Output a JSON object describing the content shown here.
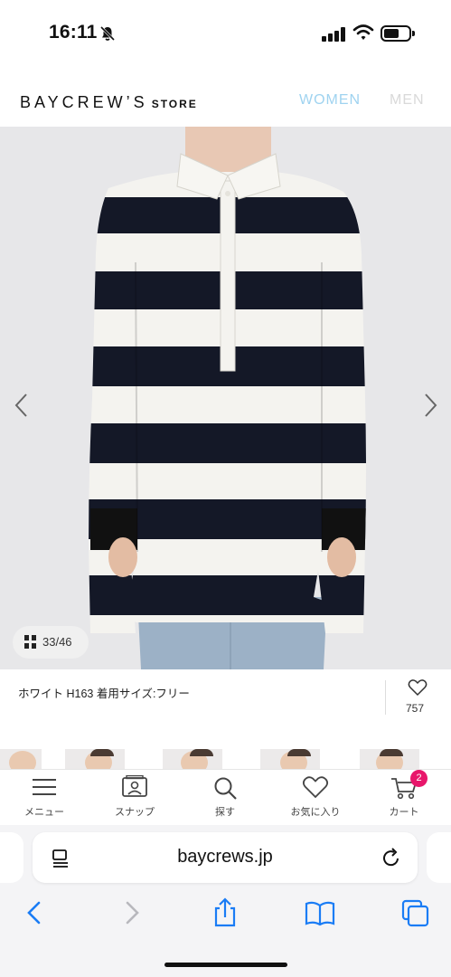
{
  "status_bar": {
    "time": "16:11",
    "icons": [
      "bell-slash-icon",
      "signal-icon",
      "wifi-icon",
      "battery-icon"
    ]
  },
  "header": {
    "logo_main": "BAYCREW’S",
    "logo_sub": "STORE",
    "nav": [
      {
        "label": "WOMEN",
        "color": "#9fd3f0",
        "active": true
      },
      {
        "label": "MEN",
        "color": "#d9d9d9",
        "active": false
      }
    ]
  },
  "gallery": {
    "counter": "33/46",
    "prev_icon": "chevron-left-icon",
    "next_icon": "chevron-right-icon"
  },
  "caption": {
    "text": "ホワイト H163 着用サイズ:フリー",
    "likes": "757",
    "like_icon": "heart-outline-icon"
  },
  "app_nav": {
    "items": [
      {
        "label": "メニュー",
        "icon": "menu-icon"
      },
      {
        "label": "スナップ",
        "icon": "snap-icon"
      },
      {
        "label": "探す",
        "icon": "search-icon"
      },
      {
        "label": "お気に入り",
        "icon": "heart-icon"
      },
      {
        "label": "カート",
        "icon": "cart-icon"
      }
    ],
    "cart_count": "2",
    "badge_color": "#e8176b"
  },
  "safari": {
    "url": "baycrews.jp",
    "toolbar_icons": [
      "back-icon",
      "forward-icon",
      "share-icon",
      "bookmarks-icon",
      "tabs-icon"
    ],
    "accent": "#1a7cf5"
  }
}
